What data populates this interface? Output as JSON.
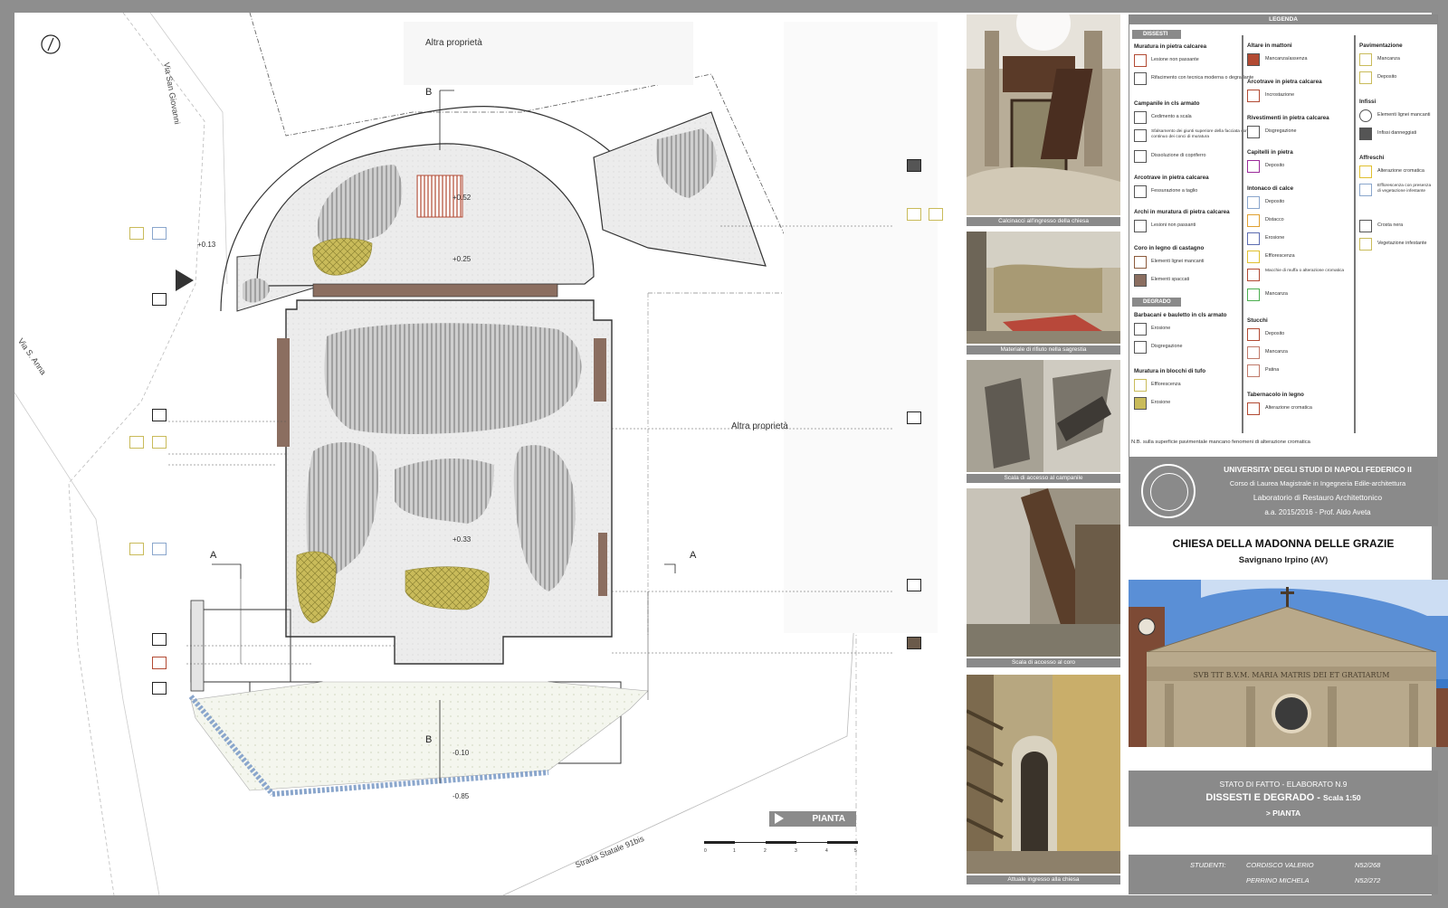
{
  "plan": {
    "labels": {
      "altra_1": "Altra proprietà",
      "altra_2": "Altra proprietà",
      "via_san_giovanni": "Via San Giovanni",
      "via_s_anna": "Via S. Anna",
      "strada_statale": "Strada Statale 91bis"
    },
    "sections": {
      "b_top": "B",
      "b_bottom": "B",
      "a_left": "A",
      "a_right": "A"
    },
    "levels": [
      "+0.13",
      "+0.52",
      "+0.25",
      "+0.33",
      "-0.10",
      "-0.85"
    ],
    "pianta": "PIANTA",
    "scale_ticks": [
      "0",
      "1",
      "2",
      "3",
      "4",
      "5"
    ]
  },
  "photos": [
    {
      "caption": "Calcinacci all'ingresso della chiesa"
    },
    {
      "caption": "Materiale di rifiuto nella sagrestia"
    },
    {
      "caption": "Scala di accesso al campanile"
    },
    {
      "caption": "Scala di accesso al coro"
    },
    {
      "caption": "Attuale ingresso alla chiesa"
    }
  ],
  "legend": {
    "title": "LEGENDA",
    "dissesti": "DISSESTI",
    "degrado": "DEGRADO",
    "col1": [
      {
        "head": "Muratura in pietra calcarea",
        "items": [
          "Lesione non passante",
          "Rifacimento con tecnica moderna o degradante"
        ]
      },
      {
        "head": "Campanile in cls armato",
        "items": [
          "Cedimento a scala",
          "Sfalsamento dei giunti superiore della facciata con continuo dei conci di muratura",
          "Dissoluzione di copriferro"
        ]
      },
      {
        "head": "Arcotrave in pietra calcarea",
        "items": [
          "Fessurazione a taglio"
        ]
      },
      {
        "head": "Archi in muratura di pietra calcarea",
        "items": [
          "Lesioni non passanti"
        ]
      },
      {
        "head": "Coro in legno di castagno",
        "items": [
          "Elementi lignei mancanti",
          "Elementi spaccati"
        ]
      }
    ],
    "col1_degrado": [
      {
        "head": "Barbacani e bauletto in cls armato",
        "items": [
          "Erosione",
          "Disgregazione"
        ]
      },
      {
        "head": "Muratura in blocchi di tufo",
        "items": [
          "Efflorescenza",
          "Erosione"
        ]
      }
    ],
    "col2": [
      {
        "head": "Altare in mattoni",
        "items": [
          "Mancanza/assenza"
        ]
      },
      {
        "head": "Arcotrave in pietra calcarea",
        "items": [
          "Incrostazione"
        ]
      },
      {
        "head": "Rivestimenti in pietra calcarea",
        "items": [
          "Disgregazione"
        ]
      },
      {
        "head": "Capitelli in pietra",
        "items": [
          "Deposito"
        ]
      },
      {
        "head": "Intonaco di calce",
        "items": [
          "Deposito",
          "Distacco",
          "Erosione",
          "Efflorescenza",
          "Macchie di muffa o alterazione cromatica",
          "Mancanza"
        ]
      },
      {
        "head": "Stucchi",
        "items": [
          "Deposito",
          "Mancanza",
          "Patina"
        ]
      },
      {
        "head": "Tabernacolo in legno",
        "items": [
          "Alterazione cromatica"
        ]
      }
    ],
    "col3": [
      {
        "head": "Pavimentazione",
        "items": [
          "Mancanza",
          "Deposito"
        ]
      },
      {
        "head": "Infissi",
        "items": [
          "Elementi lignei mancanti",
          "Infissi danneggiati"
        ]
      },
      {
        "head": "Affreschi",
        "items": [
          "Alterazione cromatica",
          "Efflorescenza con presenza di vegetazione infestante",
          "Crosta nera",
          "Vegetazione infestante"
        ]
      }
    ],
    "note": "N.B. sulla superficie pavimentale mancano fenomeni di alterazione cromatica"
  },
  "title_block": {
    "university": "UNIVERSITA' DEGLI STUDI DI NAPOLI FEDERICO II",
    "course": "Corso di Laurea Magistrale in Ingegneria Edile-architettura",
    "lab": "Laboratorio di Restauro Architettonico",
    "year": "a.a. 2015/2016 - Prof. Aldo Aveta",
    "church": "CHIESA DELLA MADONNA DELLE GRAZIE",
    "place": "Savignano Irpino (AV)",
    "facade_inscription": "SVB TIT B.V.M. MARIA MATRIS DEI ET GRATIARUM",
    "stato": "STATO DI FATTO - ELABORATO N.9",
    "dissesti": "DISSESTI E DEGRADO -",
    "scale": "Scala 1:50",
    "pianta": "> PIANTA",
    "students_label": "STUDENTI:",
    "student1": "CORDISCO VALERIO",
    "matr1": "N52/268",
    "student2": "PERRINO MICHELA",
    "matr2": "N52/272"
  },
  "colors": {
    "frame": "#8e8e8e",
    "panel": "#8a8a8a",
    "ochre": "#c9bb5a",
    "brick": "#b24a33",
    "blue": "#9fb6d6"
  }
}
